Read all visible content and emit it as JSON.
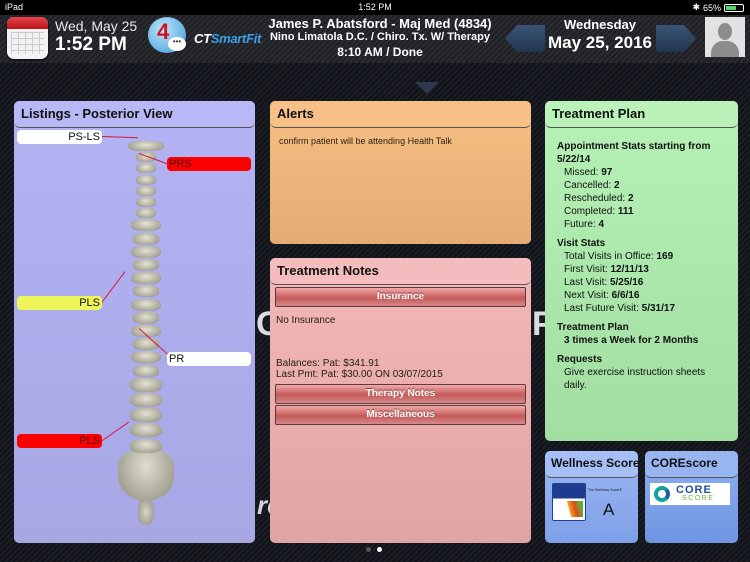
{
  "status_bar": {
    "device": "iPad",
    "time": "1:52 PM",
    "battery_percent_label": "65%",
    "battery_level": 0.65
  },
  "header": {
    "date": "Wed, May 25",
    "time": "1:52 PM",
    "message_count": "4",
    "brand_prefix": "CT",
    "brand_suffix": "SmartFit",
    "patient_name": "James P. Abatsford - Maj Med (4834)",
    "provider": "Nino Limatola D.C. / Chiro. Tx. W/ Therapy",
    "appointment": "8:10 AM / Done",
    "day_of_week": "Wednesday",
    "full_date": "May 25, 2016"
  },
  "listings": {
    "title": "Listings - Posterior View",
    "tags": [
      {
        "label": "PS-LS",
        "color": "white"
      },
      {
        "label": "PRS",
        "color": "red"
      },
      {
        "label": "PLS",
        "color": "yellow"
      },
      {
        "label": "PR",
        "color": "white"
      },
      {
        "label": "PLS",
        "color": "red"
      }
    ]
  },
  "alerts": {
    "title": "Alerts",
    "text": "confirm patient will be attending Health Talk"
  },
  "treatment_notes": {
    "title": "Treatment Notes",
    "insurance_button": "Insurance",
    "insurance_text": "No Insurance",
    "balances": "Balances: Pat: $341.91",
    "last_payment": "Last Pmt: Pat: $30.00 ON 03/07/2015",
    "therapy_button": "Therapy Notes",
    "misc_button": "Miscellaneous"
  },
  "treatment_plan": {
    "title": "Treatment Plan",
    "appt_stats_heading": "Appointment Stats starting from 5/22/14",
    "appt_stats": [
      {
        "label": "Missed:",
        "value": "97"
      },
      {
        "label": "Cancelled:",
        "value": "2"
      },
      {
        "label": "Rescheduled:",
        "value": "2"
      },
      {
        "label": "Completed:",
        "value": "111"
      },
      {
        "label": "Future:",
        "value": "4"
      }
    ],
    "visit_stats_heading": "Visit Stats",
    "visit_stats": [
      {
        "label": "Total Visits in Office:",
        "value": "169"
      },
      {
        "label": "First Visit:",
        "value": "12/11/13"
      },
      {
        "label": "Last Visit:",
        "value": "5/25/16"
      },
      {
        "label": "Next Visit:",
        "value": "6/6/16"
      },
      {
        "label": "Last Future Visit:",
        "value": "5/31/17"
      }
    ],
    "plan_heading": "Treatment Plan",
    "plan_value": "3 times a Week for 2 Months",
    "requests_heading": "Requests",
    "requests_value": "Give exercise instruction sheets daily."
  },
  "wellness": {
    "title": "Wellness Score",
    "caption": "The Wellness Score®",
    "grade": "A"
  },
  "corescore": {
    "title": "COREscore",
    "logo_top": "CORE",
    "logo_bottom": "SCORE"
  },
  "pager": {
    "pages": 2,
    "active": 2
  }
}
